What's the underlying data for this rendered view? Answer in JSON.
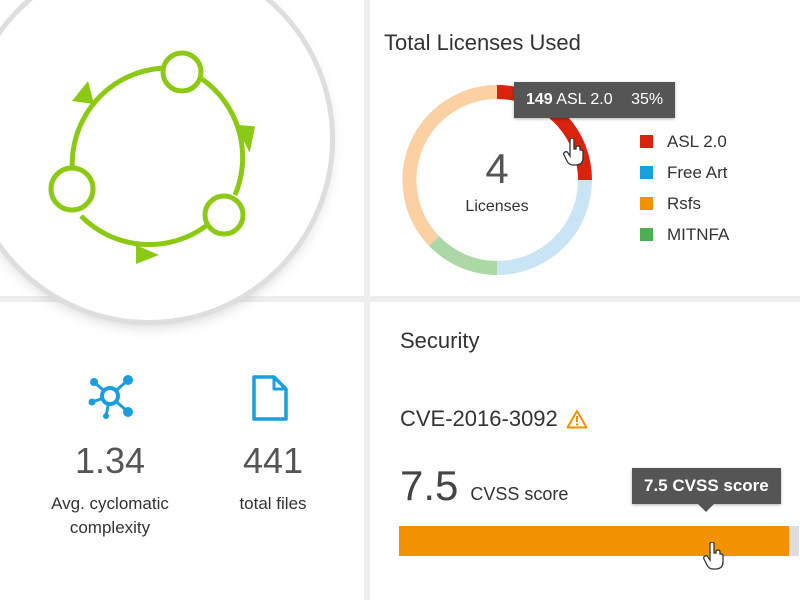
{
  "licenses": {
    "title": "Total Licenses Used",
    "center_count": "4",
    "center_label": "Licenses",
    "tooltip": {
      "count": "149",
      "name": "ASL 2.0",
      "percent": "35%"
    },
    "legend": [
      {
        "label": "ASL 2.0",
        "color": "#d9230f"
      },
      {
        "label": "Free Art",
        "color": "#1a9fde"
      },
      {
        "label": "Rsfs",
        "color": "#f39200"
      },
      {
        "label": "MITNFA",
        "color": "#4caf50"
      }
    ]
  },
  "metrics": {
    "complexity": {
      "value": "1.34",
      "label_line1": "Avg. cyclomatic",
      "label_line2": "complexity",
      "icon": "network-icon"
    },
    "files": {
      "value": "441",
      "label": "total files",
      "icon": "file-icon"
    }
  },
  "security": {
    "title": "Security",
    "cve": "CVE-2016-3092",
    "score": "7.5",
    "score_unit": "CVSS score",
    "tooltip_value": "7.5",
    "tooltip_label": "CVSS score",
    "bar_color": "#f39200",
    "bar_fill_fraction": 0.975
  },
  "accent": {
    "cycle_green": "#8cc914"
  }
}
